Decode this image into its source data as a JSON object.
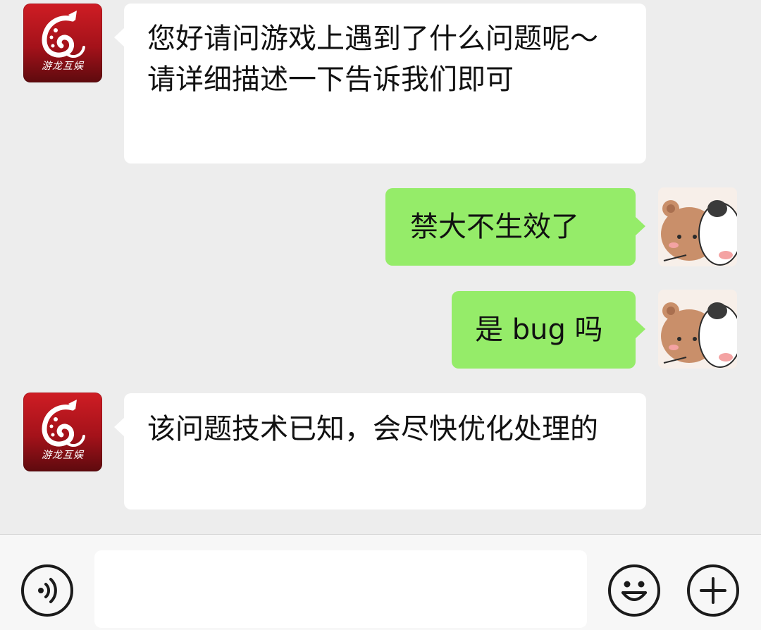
{
  "contacts": {
    "bot_logo_text": "游龙互娱"
  },
  "messages": [
    {
      "direction": "in",
      "text": "您好请问游戏上遇到了什么问题呢～请详细描述一下告诉我们即可"
    },
    {
      "direction": "out",
      "text": "禁大不生效了"
    },
    {
      "direction": "out",
      "text": "是 bug 吗"
    },
    {
      "direction": "in",
      "text": "该问题技术已知，会尽快优化处理的"
    }
  ],
  "input_bar": {
    "input_value": "",
    "left_icon": "voice-icon",
    "emoji_icon": "emoji-icon",
    "plus_icon": "plus-icon"
  },
  "colors": {
    "background": "#ededed",
    "incoming_bubble": "#ffffff",
    "outgoing_bubble": "#95ec69",
    "brand_red": "#b3151c"
  }
}
